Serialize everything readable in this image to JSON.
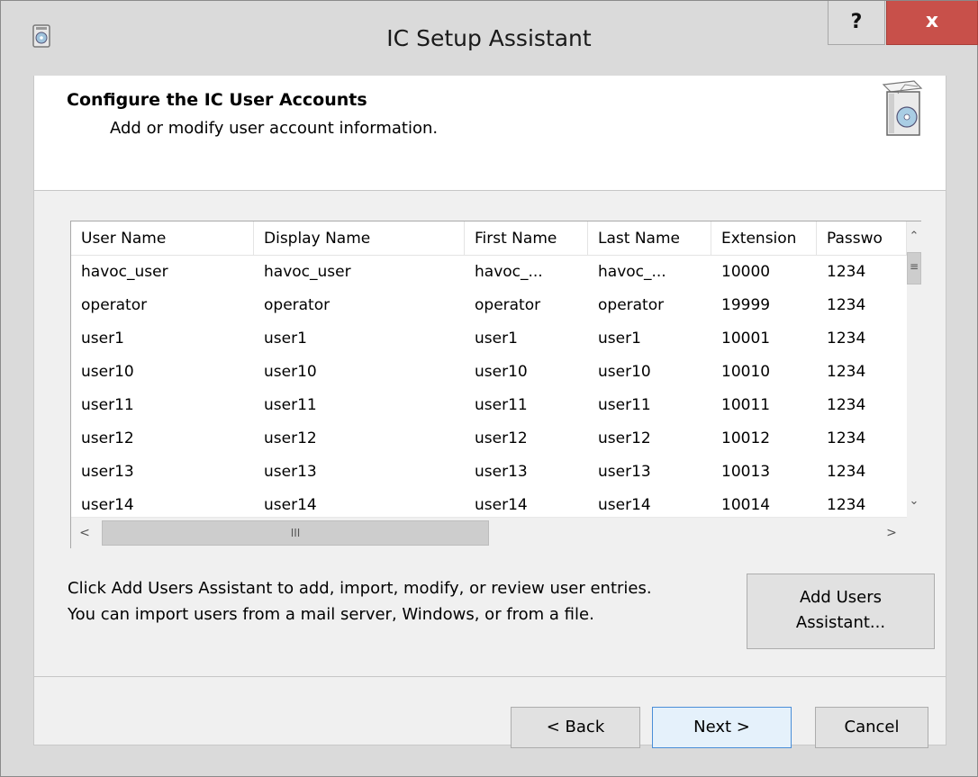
{
  "window": {
    "title": "IC Setup Assistant",
    "help_label": "?",
    "close_label": "x"
  },
  "header": {
    "title": "Configure the IC User Accounts",
    "subtitle": "Add or modify user account information."
  },
  "list": {
    "columns": [
      "User Name",
      "Display Name",
      "First Name",
      "Last Name",
      "Extension",
      "Passwo"
    ],
    "rows": [
      [
        "havoc_user",
        "havoc_user",
        "havoc_...",
        "havoc_...",
        "10000",
        "1234"
      ],
      [
        "operator",
        "operator",
        "operator",
        "operator",
        "19999",
        "1234"
      ],
      [
        "user1",
        "user1",
        "user1",
        "user1",
        "10001",
        "1234"
      ],
      [
        "user10",
        "user10",
        "user10",
        "user10",
        "10010",
        "1234"
      ],
      [
        "user11",
        "user11",
        "user11",
        "user11",
        "10011",
        "1234"
      ],
      [
        "user12",
        "user12",
        "user12",
        "user12",
        "10012",
        "1234"
      ],
      [
        "user13",
        "user13",
        "user13",
        "user13",
        "10013",
        "1234"
      ],
      [
        "user14",
        "user14",
        "user14",
        "user14",
        "10014",
        "1234"
      ]
    ]
  },
  "help_text": {
    "line1": "Click Add Users Assistant to add, import, modify, or review user entries.",
    "line2": "You can import users from a mail server, Windows, or from a file."
  },
  "buttons": {
    "add_users_line1": "Add Users",
    "add_users_line2": "Assistant...",
    "back": "< Back",
    "next": "Next >",
    "cancel": "Cancel"
  },
  "icons": {
    "app": "setup-disc-icon",
    "header": "setup-box-icon"
  }
}
